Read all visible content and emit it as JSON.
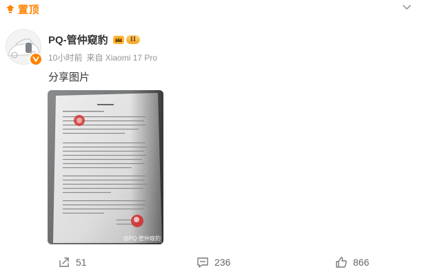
{
  "pin": {
    "label": "置顶",
    "icon": "pin-icon"
  },
  "header": {
    "chevron_icon": "chevron-down-icon"
  },
  "user": {
    "name": "PQ-管仲窥豹",
    "crown_icon": "crown-icon",
    "level": "II",
    "time": "10小时前",
    "source": "来自 Xiaomi 17 Pro",
    "verified_icon": "verified-v-icon"
  },
  "post": {
    "text": "分享图片",
    "image_watermark": "@PQ-管仲窥豹"
  },
  "actions": {
    "repost": {
      "count": "51",
      "icon": "repost-icon"
    },
    "comment": {
      "count": "236",
      "icon": "comment-icon"
    },
    "like": {
      "count": "866",
      "icon": "like-icon"
    }
  },
  "colors": {
    "accent": "#ff8200",
    "meta": "#939393",
    "text": "#333333"
  }
}
